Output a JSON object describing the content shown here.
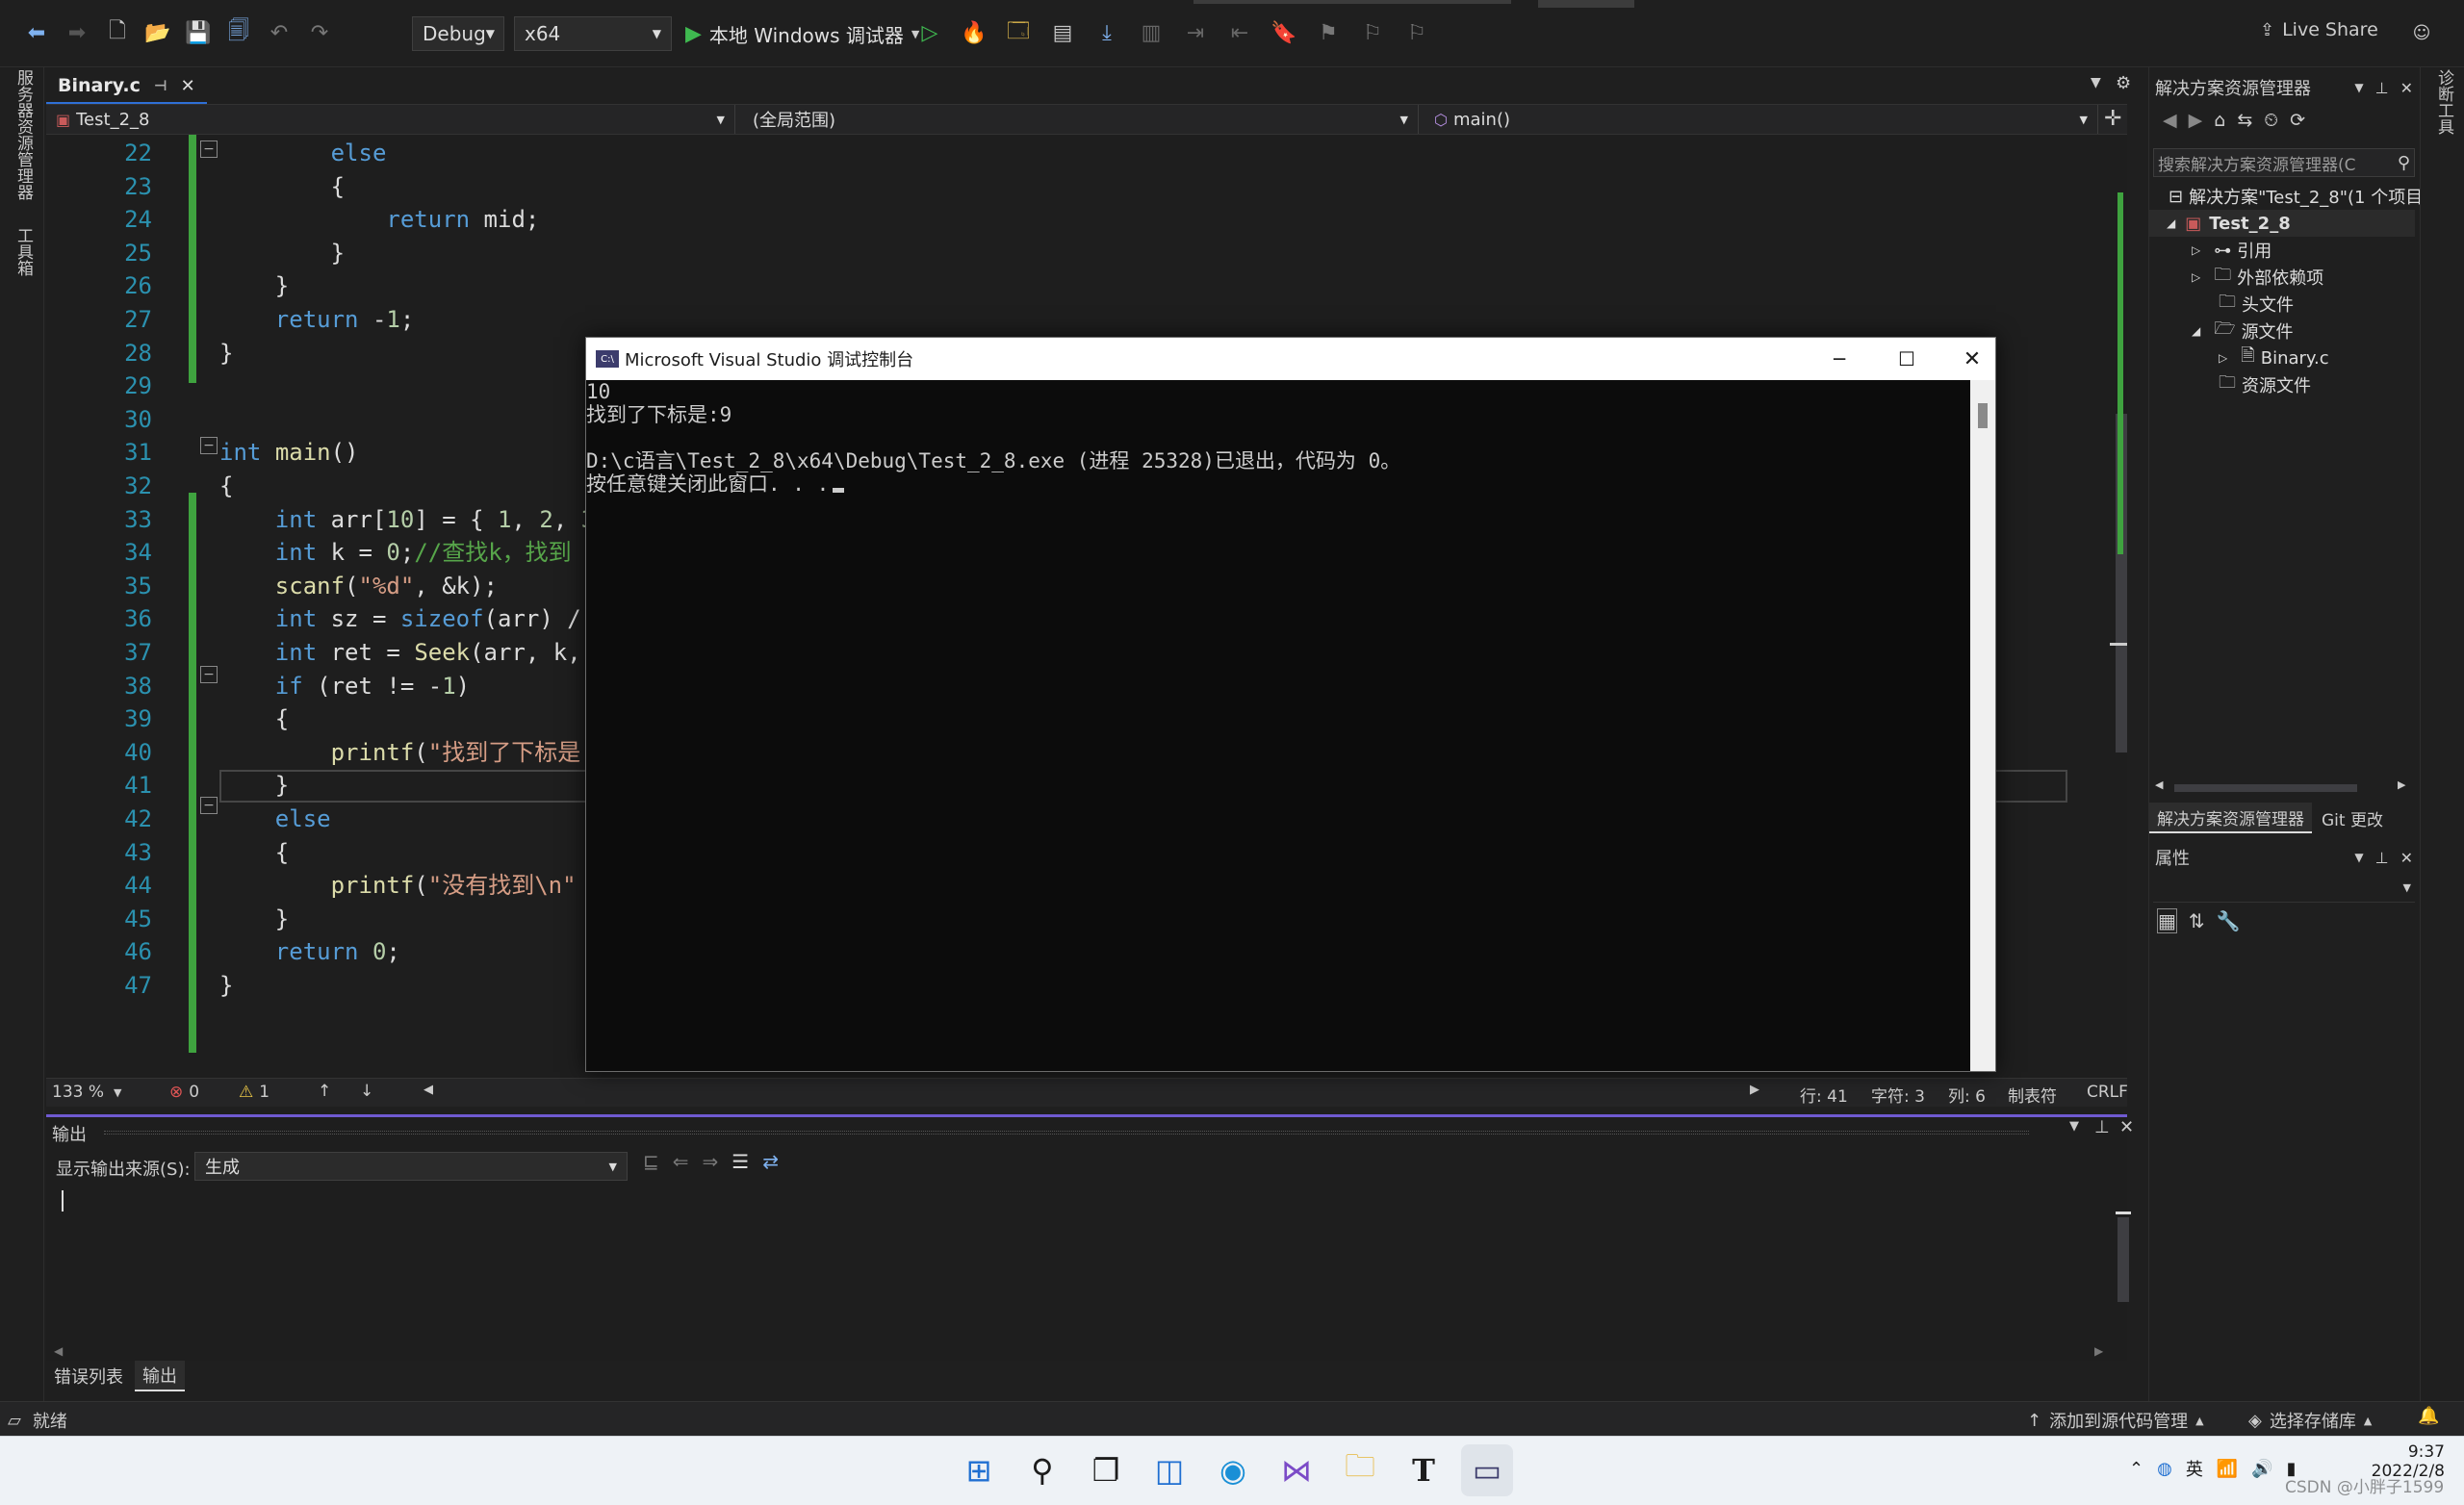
{
  "toolbar": {
    "config": "Debug",
    "platform": "x64",
    "run_label": "本地 Windows 调试器",
    "live_share": "Live Share"
  },
  "left_strip": {
    "server_explorer": "服务器资源管理器",
    "toolbox": "工具箱"
  },
  "right_strip": {
    "diagnostics": "诊断工具"
  },
  "editor": {
    "tab_title": "Binary.c",
    "nav_project": "Test_2_8",
    "nav_scope": "(全局范围)",
    "nav_member": "main()",
    "lines": [
      {
        "n": "22",
        "code": "        else"
      },
      {
        "n": "23",
        "code": "        {"
      },
      {
        "n": "24",
        "code": "            return mid;"
      },
      {
        "n": "25",
        "code": "        }"
      },
      {
        "n": "26",
        "code": "    }"
      },
      {
        "n": "27",
        "code": "    return -1;"
      },
      {
        "n": "28",
        "code": "}"
      },
      {
        "n": "29",
        "code": ""
      },
      {
        "n": "30",
        "code": ""
      },
      {
        "n": "31",
        "code": "int main()"
      },
      {
        "n": "32",
        "code": "{"
      },
      {
        "n": "33",
        "code": "    int arr[10] = { 1, 2, 3"
      },
      {
        "n": "34",
        "code": "    int k = 0;//查找k，找到"
      },
      {
        "n": "35",
        "code": "    scanf(\"%d\", &k);"
      },
      {
        "n": "36",
        "code": "    int sz = sizeof(arr) /"
      },
      {
        "n": "37",
        "code": "    int ret = Seek(arr, k,"
      },
      {
        "n": "38",
        "code": "    if (ret != -1)"
      },
      {
        "n": "39",
        "code": "    {"
      },
      {
        "n": "40",
        "code": "        printf(\"找到了下标是"
      },
      {
        "n": "41",
        "code": "    }"
      },
      {
        "n": "42",
        "code": "    else"
      },
      {
        "n": "43",
        "code": "    {"
      },
      {
        "n": "44",
        "code": "        printf(\"没有找到\\n\""
      },
      {
        "n": "45",
        "code": "    }"
      },
      {
        "n": "46",
        "code": "    return 0;"
      },
      {
        "n": "47",
        "code": "}"
      }
    ],
    "zoom": "133 %",
    "errors": "0",
    "warnings": "1",
    "row": "行: 41",
    "char": "字符: 3",
    "col": "列: 6",
    "tab_mode": "制表符",
    "line_ending": "CRLF"
  },
  "console": {
    "title": "Microsoft Visual Studio 调试控制台",
    "lines": [
      "10",
      "找到了下标是:9",
      "",
      "D:\\c语言\\Test_2_8\\x64\\Debug\\Test_2_8.exe (进程 25328)已退出，代码为 0。",
      "按任意键关闭此窗口. . ."
    ]
  },
  "output": {
    "title": "输出",
    "source_label": "显示输出来源(S):",
    "source_value": "生成",
    "tabs": [
      "错误列表",
      "输出"
    ]
  },
  "solution_explorer": {
    "title": "解决方案资源管理器",
    "search_placeholder": "搜索解决方案资源管理器(C",
    "solution": "解决方案\"Test_2_8\"(1 个项目",
    "project": "Test_2_8",
    "items": [
      "引用",
      "外部依赖项",
      "头文件",
      "源文件",
      "Binary.c",
      "资源文件"
    ],
    "bottom_tabs": [
      "解决方案资源管理器",
      "Git 更改"
    ]
  },
  "properties": {
    "title": "属性"
  },
  "statusbar": {
    "ready": "就绪",
    "add_source": "添加到源代码管理",
    "select_repo": "选择存储库"
  },
  "taskbar": {
    "ime": "英",
    "time": "9:37",
    "date": "2022/2/8",
    "watermark": "CSDN @小胖子1599"
  },
  "colors": {
    "accent": "#6f5ad1",
    "change_bar": "#3fa33f",
    "run_green": "#3fb950"
  }
}
